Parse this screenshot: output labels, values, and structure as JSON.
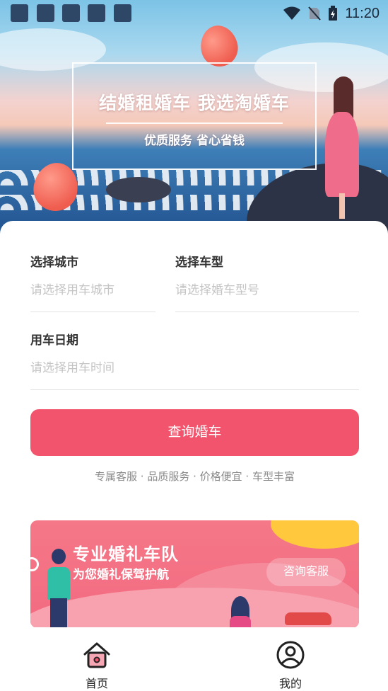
{
  "status_bar": {
    "time": "11:20",
    "notification_icons": [
      "app-icon",
      "app-icon",
      "app-icon",
      "app-icon",
      "app-icon"
    ],
    "right_icons": [
      "wifi-icon",
      "no-sim-icon",
      "battery-charging-icon"
    ]
  },
  "hero": {
    "title": "结婚租婚车  我选淘婚车",
    "subtitle": "优质服务 省心省钱"
  },
  "form": {
    "city": {
      "label": "选择城市",
      "placeholder": "请选择用车城市"
    },
    "car_type": {
      "label": "选择车型",
      "placeholder": "请选择婚车型号"
    },
    "date": {
      "label": "用车日期",
      "placeholder": "请选择用车时间"
    },
    "query_button": "查询婚车",
    "features": "专属客服 · 品质服务 · 价格便宜 · 车型丰富"
  },
  "banner": {
    "title": "专业婚礼车队",
    "subtitle": "为您婚礼保驾护航",
    "button": "咨询客服"
  },
  "bottom_nav": {
    "items": [
      {
        "label": "首页",
        "icon": "home-icon",
        "active": true
      },
      {
        "label": "我的",
        "icon": "user-icon",
        "active": false
      }
    ]
  },
  "colors": {
    "accent": "#f2546d",
    "placeholder": "#c4c4c4",
    "label": "#333333"
  }
}
